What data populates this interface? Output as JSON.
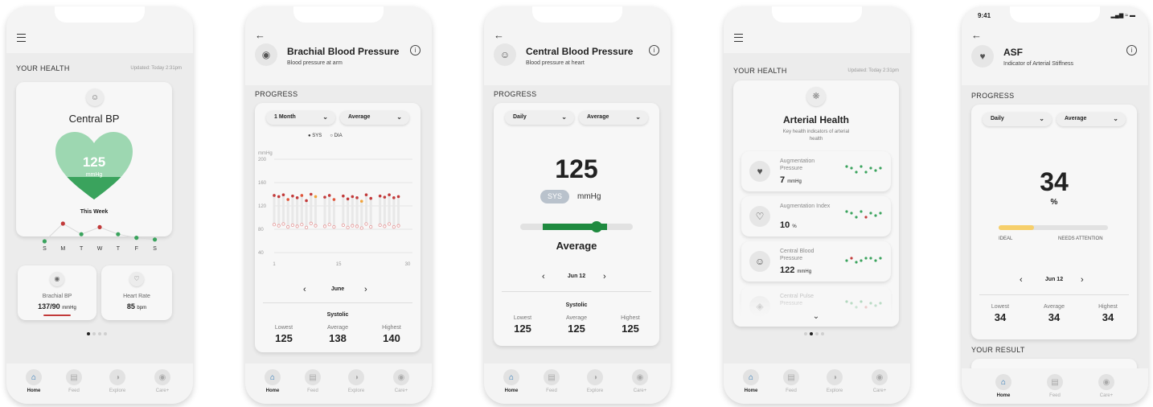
{
  "colors": {
    "green": "#3aa35d",
    "red": "#c23a3a",
    "dark_green": "#1f8a3f",
    "yellow": "#f6cf6b",
    "blue": "#1e6fb3"
  },
  "nav": {
    "home": "Home",
    "feed": "Feed",
    "explore": "Explore",
    "care": "Care+"
  },
  "screen1": {
    "section": "YOUR HEALTH",
    "updated": "Updated: Today 2:31pm",
    "card_title": "Central BP",
    "heart_value": "125",
    "heart_unit": "mmHg",
    "week_label": "This Week",
    "days": [
      "S",
      "M",
      "T",
      "W",
      "T",
      "F",
      "S"
    ],
    "week_points": [
      {
        "level": 0,
        "status": "normal"
      },
      {
        "level": 1,
        "status": "high"
      },
      {
        "level": 0.4,
        "status": "normal"
      },
      {
        "level": 0.8,
        "status": "high"
      },
      {
        "level": 0.4,
        "status": "normal"
      },
      {
        "level": 0.2,
        "status": "normal"
      },
      {
        "level": 0.1,
        "status": "normal"
      }
    ],
    "brachial_label": "Brachial BP",
    "brachial_value": "137/90",
    "brachial_unit": "mmHg",
    "hr_label": "Heart Rate",
    "hr_value": "85",
    "hr_unit": "bpm"
  },
  "screen2": {
    "title": "Brachial Blood Pressure",
    "subtitle": "Blood pressure at arm",
    "section": "PROGRESS",
    "dd1": "1 Month",
    "dd2": "Average",
    "legend_sys": "SYS",
    "legend_dia": "DIA",
    "chart_data": {
      "type": "scatter",
      "ylabel": "mmHg",
      "yticks": [
        200,
        160,
        120,
        80,
        40
      ],
      "xticks": [
        1,
        15,
        30
      ],
      "ylim": [
        40,
        200
      ]
    },
    "month": "June",
    "stats_title": "Systolic",
    "lowest_label": "Lowest",
    "lowest": "125",
    "average_label": "Average",
    "average": "138",
    "highest_label": "Highest",
    "highest": "140"
  },
  "screen3": {
    "title": "Central Blood Pressure",
    "subtitle": "Blood pressure at heart",
    "section": "PROGRESS",
    "dd1": "Daily",
    "dd2": "Average",
    "big_value": "125",
    "badge": "SYS",
    "unit": "mmHg",
    "level": 0.68,
    "status": "Average",
    "date": "Jun 12",
    "stats_title": "Systolic",
    "lowest_label": "Lowest",
    "lowest": "125",
    "average_label": "Average",
    "average": "125",
    "highest_label": "Highest",
    "highest": "125"
  },
  "screen4": {
    "section": "YOUR HEALTH",
    "updated": "Updated: Today 2:31pm",
    "title": "Arterial Health",
    "subtitle": "Key health indicators of arterial health",
    "items": [
      {
        "label": "Augmentation Pressure",
        "value": "7",
        "unit": "mmHg"
      },
      {
        "label": "Augmentation Index",
        "value": "10",
        "unit": "%"
      },
      {
        "label": "Central Blood Pressure",
        "value": "122",
        "unit": "mmHg"
      },
      {
        "label": "Central Pulse Pressure",
        "value": "",
        "unit": ""
      }
    ]
  },
  "screen5": {
    "time": "9:41",
    "title": "ASF",
    "subtitle": "Indicator of Arterial Stiffness",
    "section": "PROGRESS",
    "dd1": "Daily",
    "dd2": "Average",
    "big_value": "34",
    "unit": "%",
    "level": 0.32,
    "ideal": "IDEAL",
    "needs": "NEEDS ATTENTION",
    "date": "Jun 12",
    "lowest_label": "Lowest",
    "lowest": "34",
    "average_label": "Average",
    "average": "34",
    "highest_label": "Highest",
    "highest": "34",
    "result_section": "YOUR RESULT"
  }
}
